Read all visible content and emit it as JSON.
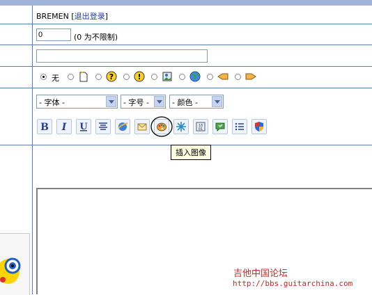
{
  "user": {
    "name": "BREMEN",
    "logout": "退出登录"
  },
  "limit": {
    "value": "0",
    "note": "(0 为不限制)"
  },
  "title_input": {
    "value": ""
  },
  "post_icons": {
    "none_label": "无",
    "icons": [
      "page-icon",
      "question-icon",
      "exclamation-icon",
      "picture-icon",
      "globe-icon",
      "hand-left-icon",
      "hand-right-icon"
    ]
  },
  "selects": {
    "font": "- 字体 -",
    "size": "- 字号 -",
    "color": "- 颜色 -"
  },
  "toolbar": [
    "bold",
    "italic",
    "underline",
    "center",
    "link",
    "email",
    "insert-image",
    "flash",
    "media",
    "quote",
    "list",
    "code"
  ],
  "tooltip": "插入图像",
  "watermark": {
    "name": "吉他中国论坛",
    "url": "http://bbs.guitarchina.com"
  }
}
